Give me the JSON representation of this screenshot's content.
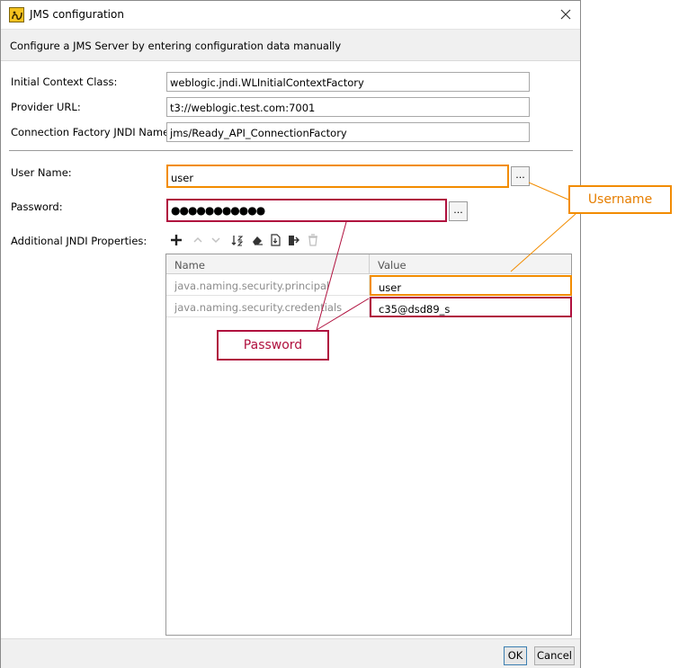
{
  "window": {
    "title": "JMS configuration",
    "header": "Configure a JMS Server by entering configuration data manually"
  },
  "form": {
    "initial_context_class": {
      "label": "Initial Context Class:",
      "value": "weblogic.jndi.WLInitialContextFactory"
    },
    "provider_url": {
      "label": "Provider URL:",
      "value": "t3://weblogic.test.com:7001"
    },
    "connection_factory": {
      "label": "Connection Factory JNDI Name:",
      "value": "jms/Ready_API_ConnectionFactory"
    },
    "user_name": {
      "label": "User Name:",
      "value": "user",
      "browse": "..."
    },
    "password": {
      "label": "Password:",
      "value": "●●●●●●●●●●●",
      "browse": "..."
    },
    "jndi_label": "Additional JNDI Properties:"
  },
  "table": {
    "headers": [
      "Name",
      "Value"
    ],
    "rows": [
      {
        "name": "java.naming.security.principal",
        "value": "user"
      },
      {
        "name": "java.naming.security.credentials",
        "value": "c35@dsd89_s"
      }
    ]
  },
  "footer": {
    "ok": "OK",
    "cancel": "Cancel"
  },
  "callouts": {
    "username": "Username",
    "password": "Password"
  },
  "colors": {
    "orange": "#f28c00",
    "red": "#b0103e"
  }
}
